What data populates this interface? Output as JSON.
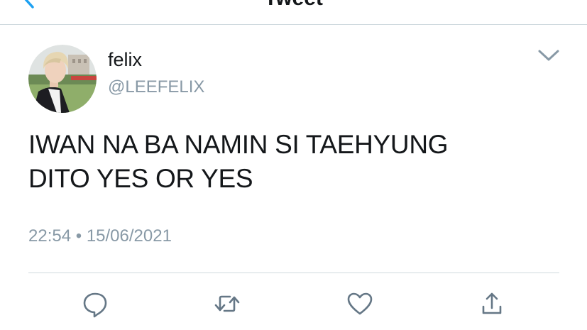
{
  "header": {
    "title": "Tweet",
    "back_icon": "chevron-left-icon"
  },
  "tweet": {
    "author": {
      "display_name": "felix",
      "handle": "@LEEFELIX",
      "avatar_icon": "profile-photo"
    },
    "text_lines": [
      "IWAN NA BA NAMIN SI TAEHYUNG",
      "DITO YES OR YES"
    ],
    "time": "22:54",
    "separator": "•",
    "date": "15/06/2021",
    "menu_icon": "chevron-down-icon"
  },
  "actions": {
    "reply_icon": "reply-icon",
    "retweet_icon": "retweet-icon",
    "like_icon": "heart-icon",
    "share_icon": "share-icon"
  },
  "colors": {
    "accent": "#1da1f2",
    "text": "#14171a",
    "secondary": "#8899a6",
    "icon": "#657786",
    "divider": "#cfd9de"
  }
}
